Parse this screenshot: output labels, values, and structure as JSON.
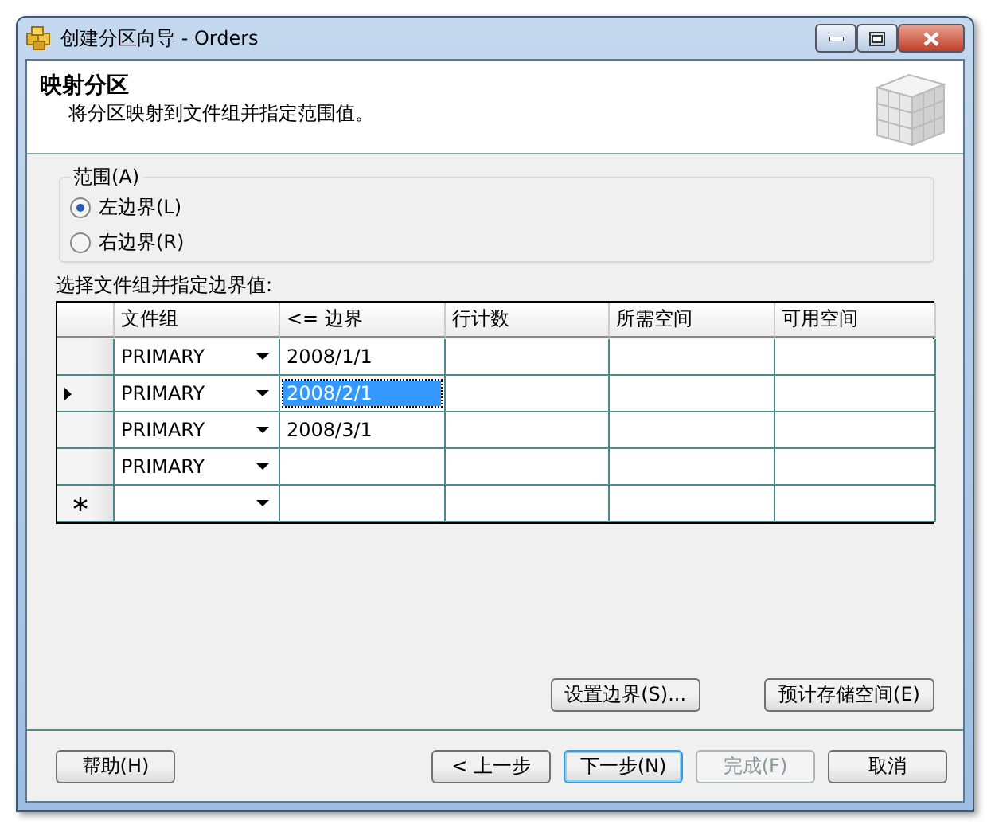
{
  "window": {
    "title": "创建分区向导 - Orders"
  },
  "header": {
    "title": "映射分区",
    "subtitle": "将分区映射到文件组并指定范围值。"
  },
  "range": {
    "label": "范围(A)",
    "options": [
      {
        "label": "左边界(L)",
        "selected": true
      },
      {
        "label": "右边界(R)",
        "selected": false
      }
    ]
  },
  "grid_label": "选择文件组并指定边界值:",
  "table": {
    "columns": [
      "文件组",
      "<= 边界",
      "行计数",
      "所需空间",
      "可用空间"
    ],
    "rows": [
      {
        "kind": "data",
        "current": false,
        "filegroup": "PRIMARY",
        "boundary": "2008/1/1",
        "boundary_selected": false
      },
      {
        "kind": "data",
        "current": true,
        "filegroup": "PRIMARY",
        "boundary": "2008/2/1",
        "boundary_selected": true
      },
      {
        "kind": "data",
        "current": false,
        "filegroup": "PRIMARY",
        "boundary": "2008/3/1",
        "boundary_selected": false
      },
      {
        "kind": "data",
        "current": false,
        "filegroup": "PRIMARY",
        "boundary_selected": false
      },
      {
        "kind": "new",
        "current": false,
        "boundary_selected": false
      }
    ]
  },
  "actions": [
    {
      "label": "设置边界(S)..."
    },
    {
      "label": "预计存储空间(E)"
    }
  ],
  "footer": {
    "help": {
      "label": "帮助(H)"
    },
    "nav": [
      {
        "label": "< 上一步",
        "disabled": false,
        "default": false
      },
      {
        "label": "下一步(N)",
        "disabled": false,
        "default": true
      },
      {
        "label": "完成(F)",
        "disabled": true,
        "default": false
      },
      {
        "label": "取消",
        "disabled": false,
        "default": false
      }
    ]
  }
}
